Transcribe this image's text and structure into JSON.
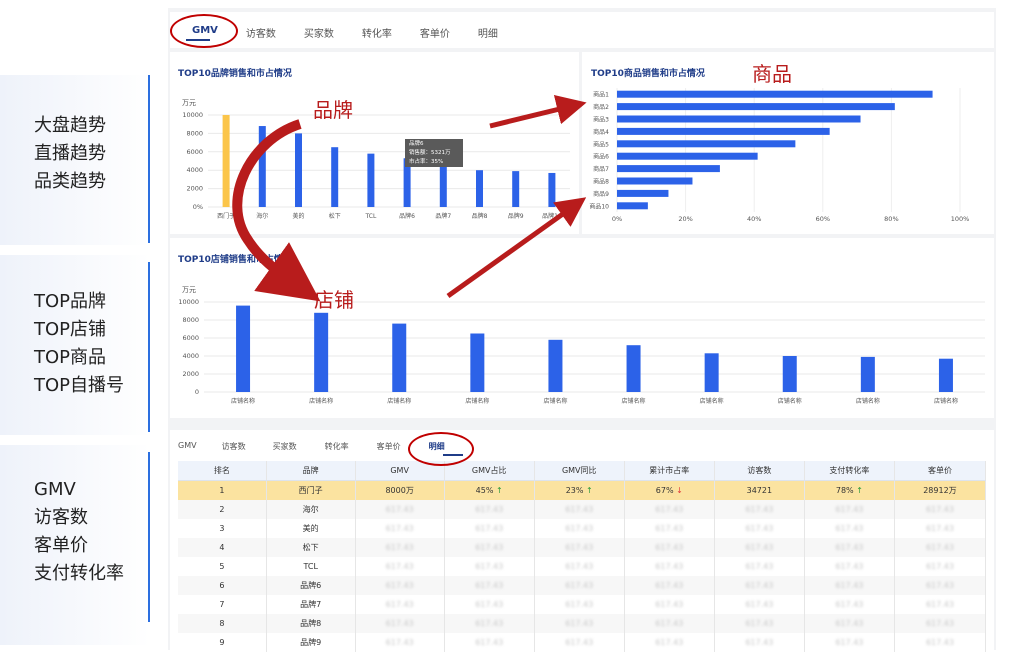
{
  "sidebar_groups": [
    [
      "大盘趋势",
      "直播趋势",
      "品类趋势"
    ],
    [
      "TOP品牌",
      "TOP店铺",
      "TOP商品",
      "TOP自播号"
    ],
    [
      "GMV",
      "访客数",
      "客单价",
      "支付转化率"
    ]
  ],
  "top_tabs": [
    "GMV",
    "访客数",
    "买家数",
    "转化率",
    "客单价",
    "明细"
  ],
  "bottom_tabs": [
    "GMV",
    "访客数",
    "买家数",
    "转化率",
    "客单价",
    "明细"
  ],
  "annotations": {
    "brand": "品牌",
    "product": "商品",
    "store": "店铺"
  },
  "chart_data": [
    {
      "type": "bar",
      "title": "TOP10品牌销售和市占情况",
      "ylabel": "万元",
      "categories": [
        "西门子",
        "海尔",
        "美的",
        "松下",
        "TCL",
        "品牌6",
        "品牌7",
        "品牌8",
        "品牌9",
        "品牌10"
      ],
      "values": [
        10300,
        8800,
        8000,
        6500,
        5800,
        5300,
        4700,
        4000,
        3900,
        3700
      ],
      "ylim": [
        0,
        10000
      ],
      "yticks": [
        "0%",
        "2000",
        "4000",
        "6000",
        "8000",
        "10000"
      ],
      "highlight_color": "#fbc54a",
      "bar_color": "#2c62e8",
      "tooltip": {
        "title": "品牌6",
        "line1": "销售额：5321万",
        "line2": "市占率：35%"
      }
    },
    {
      "type": "bar",
      "title": "TOP10商品销售和市占情况",
      "orientation": "horizontal",
      "categories": [
        "商品1",
        "商品2",
        "商品3",
        "商品4",
        "商品5",
        "商品6",
        "商品7",
        "商品8",
        "商品9",
        "商品10"
      ],
      "values": [
        92,
        81,
        71,
        62,
        52,
        41,
        30,
        22,
        15,
        9
      ],
      "xlim": [
        0,
        100
      ],
      "xticks": [
        "0%",
        "20%",
        "40%",
        "60%",
        "80%",
        "100%"
      ],
      "bar_color": "#2c62e8"
    },
    {
      "type": "bar",
      "title": "TOP10店铺销售和市占情况",
      "ylabel": "万元",
      "categories": [
        "店铺名称",
        "店铺名称",
        "店铺名称",
        "店铺名称",
        "店铺名称",
        "店铺名称",
        "店铺名称",
        "店铺名称",
        "店铺名称",
        "店铺名称"
      ],
      "values": [
        9600,
        8800,
        7600,
        6500,
        5800,
        5200,
        4300,
        4000,
        3900,
        3700
      ],
      "ylim": [
        0,
        10000
      ],
      "yticks": [
        "0",
        "2000",
        "4000",
        "6000",
        "8000",
        "10000"
      ],
      "bar_color": "#2c62e8"
    }
  ],
  "table": {
    "headers": [
      "排名",
      "品牌",
      "GMV",
      "GMV占比",
      "GMV同比",
      "累计市占率",
      "访客数",
      "支付转化率",
      "客单价"
    ],
    "first_row": {
      "rank": "1",
      "brand": "西门子",
      "gmv": "8000万",
      "share": "45%",
      "yoy": "23%",
      "cum": "67%",
      "visitors": "34721",
      "conv": "78%",
      "aov": "28912万"
    },
    "rows": [
      [
        "2",
        "海尔"
      ],
      [
        "3",
        "美的"
      ],
      [
        "4",
        "松下"
      ],
      [
        "5",
        "TCL"
      ],
      [
        "6",
        "品牌6"
      ],
      [
        "7",
        "品牌7"
      ],
      [
        "8",
        "品牌8"
      ],
      [
        "9",
        "品牌9"
      ]
    ],
    "placeholder": "617.43"
  }
}
